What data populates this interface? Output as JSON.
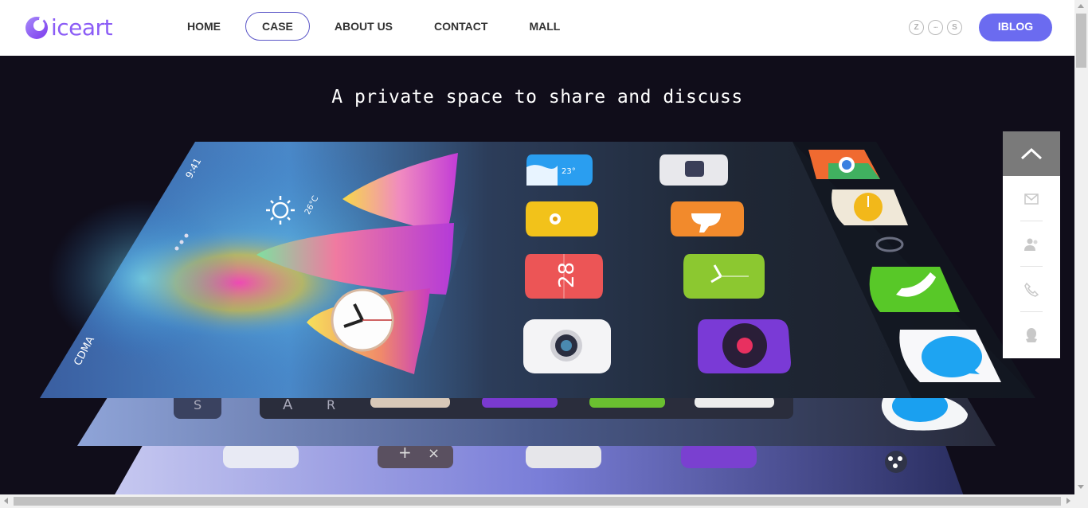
{
  "logo": {
    "text": "iceart"
  },
  "nav": {
    "home": "HOME",
    "case": "CASE",
    "about": "ABOUT US",
    "contact": "CONTACT",
    "mall": "MALL"
  },
  "social": {
    "zhihu": "Z",
    "more": "···",
    "weibo": "S"
  },
  "iblog": "IBLOG",
  "hero": {
    "title": "A private space to share and discuss",
    "screen": {
      "status_time": "9:41",
      "carrier": "CDMA",
      "weather_temp": "26°C",
      "calendar_day": "28",
      "app_temp": "23°",
      "letter_a": "A",
      "letter_r": "R",
      "letter_s": "S",
      "calc_plus": "+",
      "calc_times": "×"
    }
  },
  "side_panel": {
    "icons": [
      "chevron-up-icon",
      "mail-icon",
      "users-icon",
      "phone-icon",
      "qq-icon"
    ]
  },
  "colors": {
    "accent": "#6b6bf0",
    "nav_active_border": "#5a55c7",
    "hero_bg": "#100d1a",
    "logo": "#8b5cf6"
  }
}
